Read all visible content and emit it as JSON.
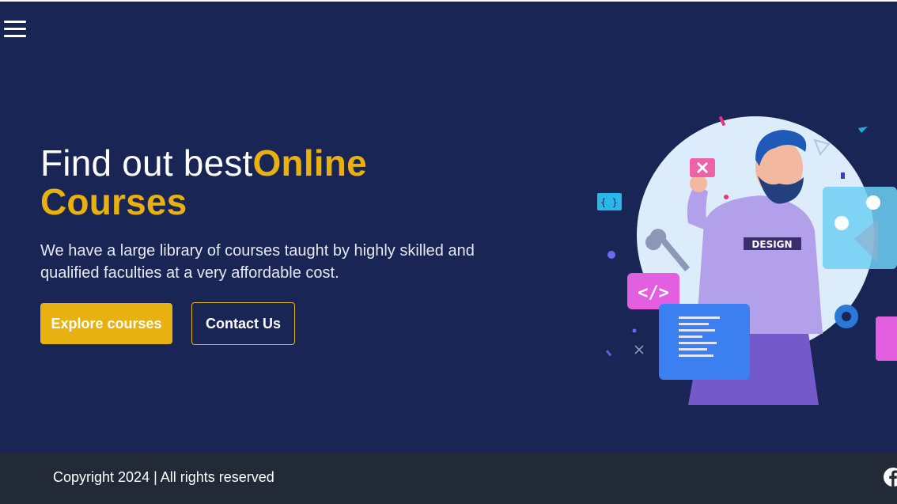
{
  "nav": {
    "menu_icon": "hamburger-menu-icon"
  },
  "hero": {
    "headline_prefix": "Find out best",
    "headline_highlight_1": "Online",
    "headline_highlight_2": "Courses",
    "description": "We have a large library of courses taught by highly skilled and qualified faculties at a very affordable cost.",
    "primary_button": "Explore courses",
    "secondary_button": "Contact Us",
    "illustration_badge": "DESIGN",
    "illustration_icons": [
      "code-brackets-icon",
      "wrench-icon",
      "code-tag-icon",
      "gear-icon",
      "close-icon",
      "play-icon"
    ]
  },
  "footer": {
    "copyright": "Copyright 2024 | All rights reserved",
    "social_icon": "facebook-icon"
  },
  "colors": {
    "hero_background": "#192555",
    "accent": "#e9b10f",
    "footer_background": "#222a38",
    "text": "#ffffff"
  }
}
